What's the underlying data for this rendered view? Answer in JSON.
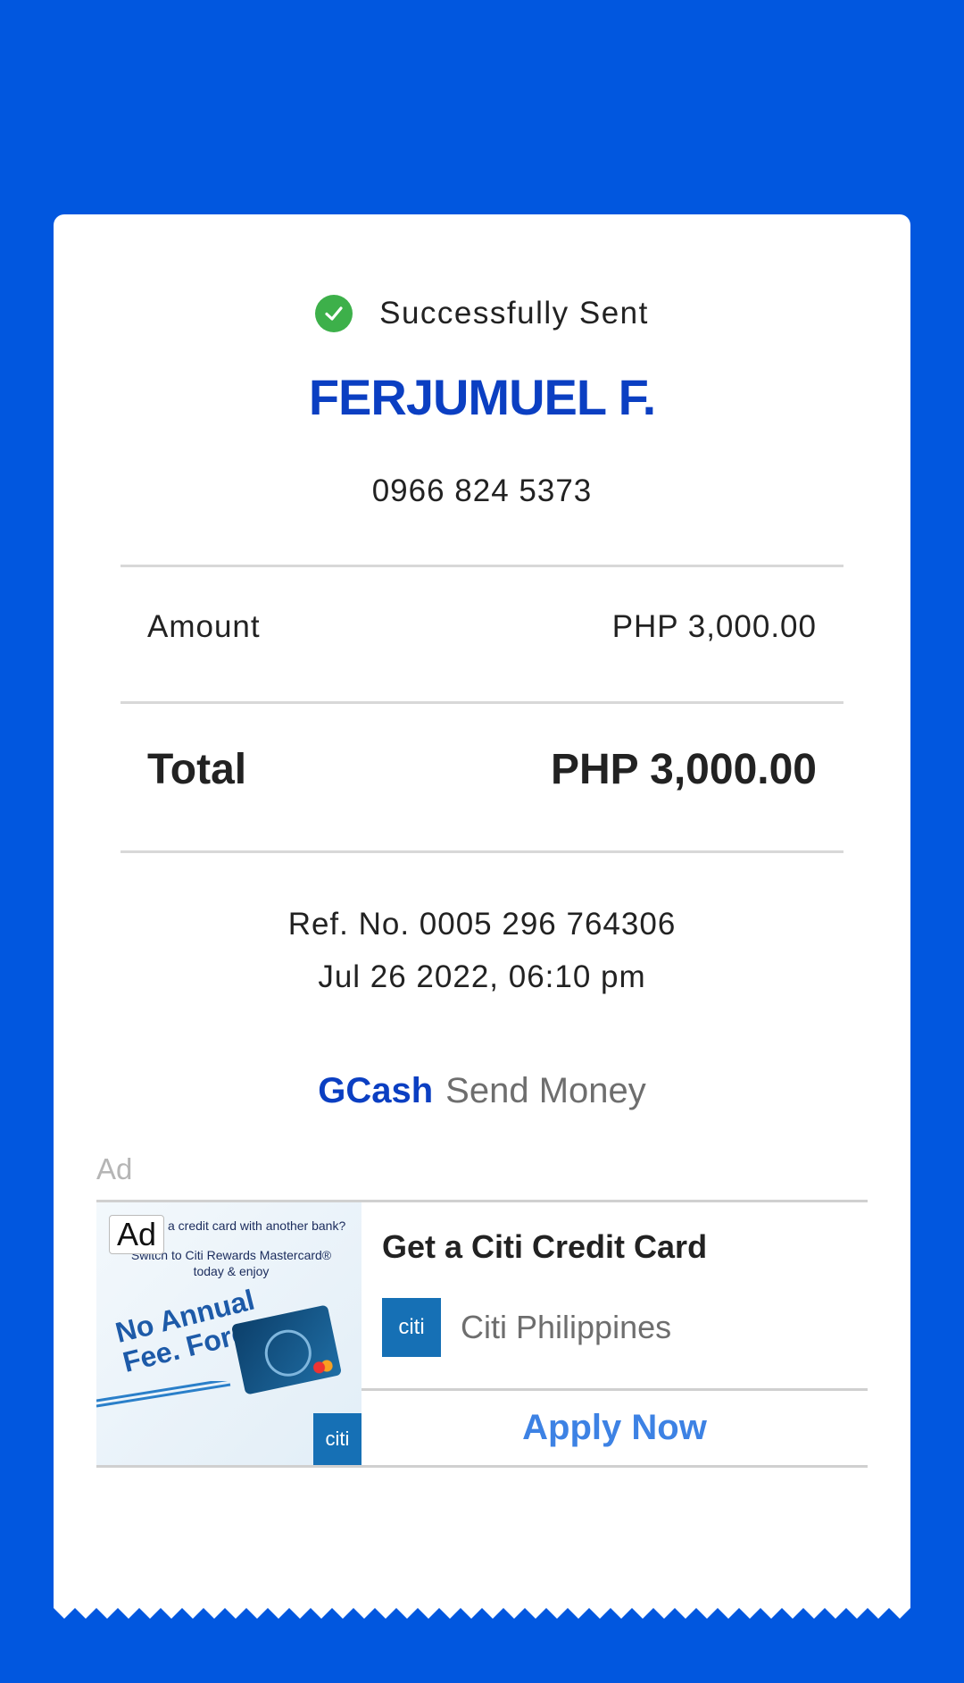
{
  "status": {
    "text": "Successfully Sent",
    "icon": "check-circle-icon",
    "color": "#3db04a"
  },
  "recipient": {
    "name": "FERJUMUEL F.",
    "phone": "0966 824 5373"
  },
  "amount": {
    "label": "Amount",
    "value": "PHP 3,000.00"
  },
  "total": {
    "label": "Total",
    "value": "PHP 3,000.00"
  },
  "reference": {
    "ref_no": "Ref. No. 0005 296 764306",
    "datetime": "Jul 26 2022, 06:10 pm"
  },
  "brand": {
    "name": "GCash",
    "service": "Send Money"
  },
  "ad": {
    "label": "Ad",
    "badge": "Ad",
    "image_text": {
      "line1": "a credit card with another bank?",
      "line2": "Switch to Citi Rewards Mastercard® today & enjoy",
      "headline": "No Annual Fee. Forever.",
      "logo": "citi"
    },
    "title": "Get a Citi Credit Card",
    "advertiser": "Citi Philippines",
    "logo_text": "citi",
    "cta": "Apply Now"
  },
  "colors": {
    "background": "#0157df",
    "primary": "#0b3fc2",
    "cta": "#3d82e4"
  }
}
